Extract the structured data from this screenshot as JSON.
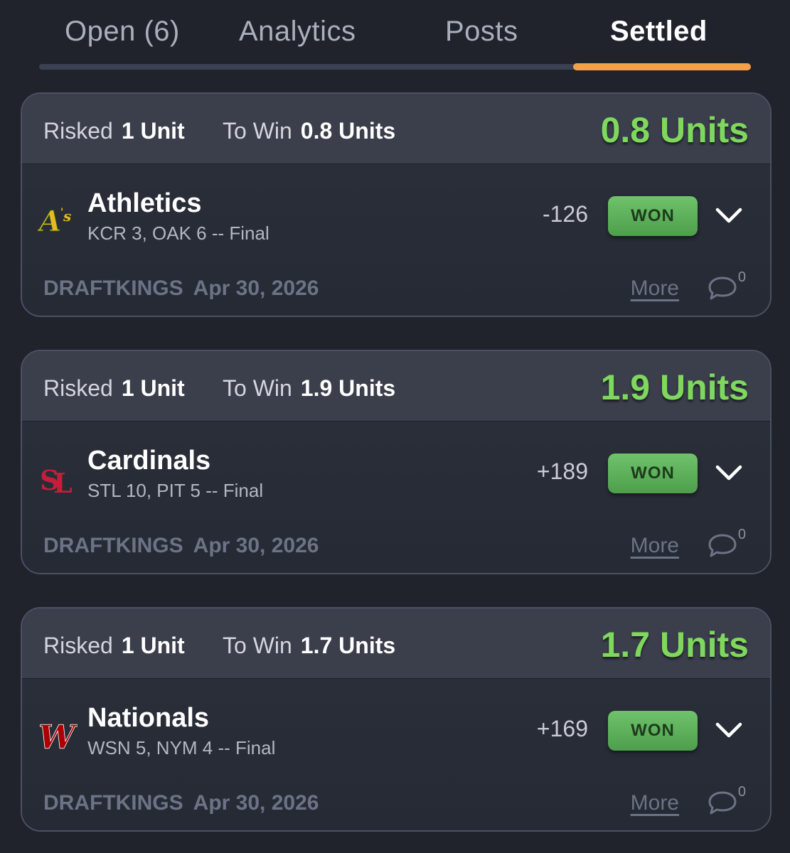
{
  "tabs": [
    {
      "label": "Open (6)"
    },
    {
      "label": "Analytics"
    },
    {
      "label": "Posts"
    },
    {
      "label": "Settled"
    }
  ],
  "active_tab": "Settled",
  "colors": {
    "background": "#20232c",
    "accent": "#f3a04a",
    "payout_green": "#7fd85e",
    "won_badge": "#5bb058"
  },
  "bets": [
    {
      "risked_label": "Risked",
      "risked_value": "1 Unit",
      "towin_label": "To Win",
      "towin_value": "0.8 Units",
      "payout": "0.8 Units",
      "team": "Athletics",
      "team_icon": "athletics-logo-icon",
      "score": "KCR 3, OAK 6 -- Final",
      "odds": "-126",
      "status": "WON",
      "book": "DRAFTKINGS",
      "date": "Apr 30, 2026",
      "more": "More",
      "comments": "0"
    },
    {
      "risked_label": "Risked",
      "risked_value": "1 Unit",
      "towin_label": "To Win",
      "towin_value": "1.9 Units",
      "payout": "1.9 Units",
      "team": "Cardinals",
      "team_icon": "cardinals-logo-icon",
      "score": "STL 10, PIT 5 -- Final",
      "odds": "+189",
      "status": "WON",
      "book": "DRAFTKINGS",
      "date": "Apr 30, 2026",
      "more": "More",
      "comments": "0"
    },
    {
      "risked_label": "Risked",
      "risked_value": "1 Unit",
      "towin_label": "To Win",
      "towin_value": "1.7 Units",
      "payout": "1.7 Units",
      "team": "Nationals",
      "team_icon": "nationals-logo-icon",
      "score": "WSN 5, NYM 4 -- Final",
      "odds": "+169",
      "status": "WON",
      "book": "DRAFTKINGS",
      "date": "Apr 30, 2026",
      "more": "More",
      "comments": "0"
    }
  ]
}
